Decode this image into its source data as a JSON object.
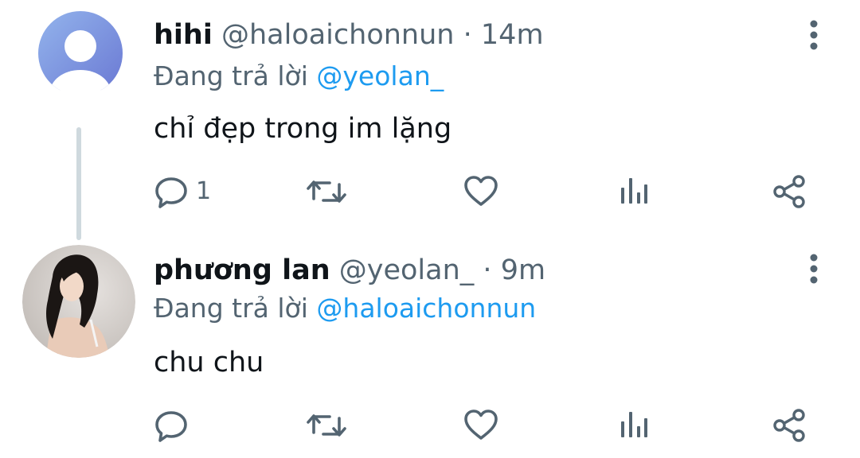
{
  "tweets": [
    {
      "name": "hihi",
      "handle": "@haloaichonnun",
      "separator": "·",
      "time": "14m",
      "reply_prefix": "Đang trả lời",
      "reply_to": "@yeolan_",
      "text": "chỉ đẹp trong im lặng",
      "reply_count": "1",
      "avatar": "default-avatar-icon"
    },
    {
      "name": "phương lan",
      "handle": "@yeolan_",
      "separator": "·",
      "time": "9m",
      "reply_prefix": "Đang trả lời",
      "reply_to": "@haloaichonnun",
      "text": "chu chu",
      "reply_count": "",
      "avatar": "profile-photo"
    }
  ],
  "colors": {
    "icon_gray": "#536471",
    "mention_blue": "#1d9bf0",
    "thread_line": "#cfd9de",
    "default_avatar_start": "#8ea8e6",
    "default_avatar_end": "#6b7fd6"
  }
}
